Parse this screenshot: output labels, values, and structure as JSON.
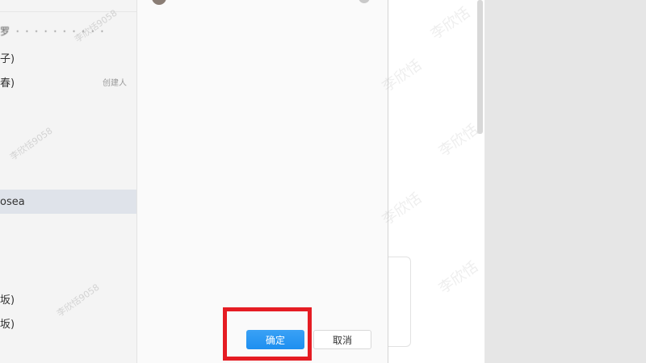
{
  "dialog": {
    "left_list": {
      "items": [
        {
          "label": "子)",
          "role": ""
        },
        {
          "label": "春)",
          "role": "创建人"
        },
        {
          "label": "osea",
          "role": "",
          "selected": true
        },
        {
          "label": "坂)",
          "role": ""
        },
        {
          "label": "坂)",
          "role": ""
        }
      ]
    },
    "footer": {
      "confirm_label": "确定",
      "cancel_label": "取消"
    }
  },
  "watermark": {
    "text": "李欣恬9058",
    "name_only": "李欣恬"
  },
  "colors": {
    "confirm_button": "#1d8ff0",
    "highlight_box": "#e51c23",
    "selected_row": "#dfe3ea"
  }
}
